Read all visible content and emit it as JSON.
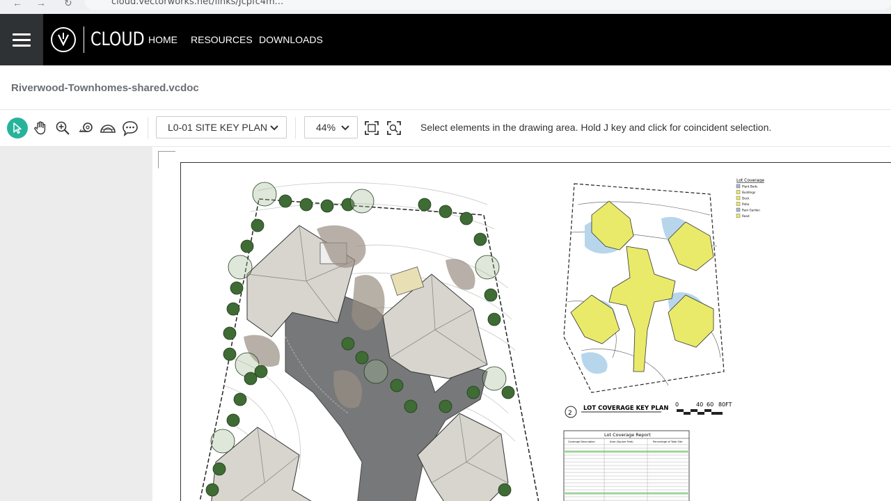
{
  "browser": {
    "url": "cloud.vectorworks.net/links/Jcpfc4m..."
  },
  "nav": {
    "brand": "CLOUD",
    "links": [
      "HOME",
      "RESOURCES",
      "DOWNLOADS"
    ]
  },
  "document": {
    "title": "Riverwood-Townhomes-shared.vcdoc"
  },
  "toolbar": {
    "sheet_select": "L0-01 SITE KEY PLAN",
    "zoom_select": "44%",
    "hint": "Select elements in the drawing area. Hold J key and click for coincident selection."
  },
  "drawing": {
    "legend_title": "Lot Coverage",
    "legend_items": [
      "Plant Beds",
      "Buildings",
      "Deck",
      "Patio",
      "Rain Garden",
      "Road"
    ],
    "legend_colors": [
      "#a9b7d8",
      "#e9ea6a",
      "#e9ea6a",
      "#e9ea6a",
      "#a9b7d8",
      "#e9ea6a"
    ],
    "key_plan_number": "2",
    "key_plan_title": "LOT COVERAGE KEY PLAN",
    "scale_labels": [
      "0",
      "40",
      "60",
      "80FT"
    ],
    "report_title": "Lot Coverage Report",
    "report_headers": [
      "Coverage Description",
      "Area (Square Feet)",
      "Percentage of Total Site"
    ]
  },
  "colors": {
    "accent": "#27b39b",
    "nav_bg": "#000000",
    "menu_bg": "#2f3235",
    "building": "#e9ea6a",
    "water": "#b7d6ec"
  }
}
